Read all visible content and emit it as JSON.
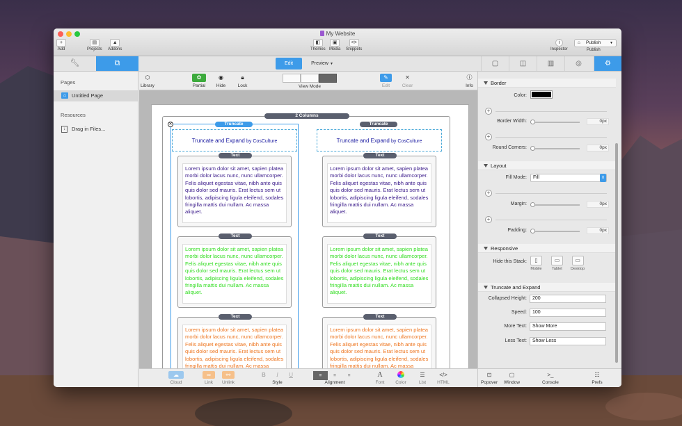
{
  "window": {
    "title": "My Website"
  },
  "toolbar": {
    "add": "Add",
    "projects": "Projects",
    "addons": "Addons",
    "themes": "Themes",
    "media": "Media",
    "snippets": "Snippets",
    "inspector": "Inspector",
    "publish_btn": "Publish",
    "publish": "Publish"
  },
  "tabs": {
    "edit": "Edit",
    "preview": "Preview"
  },
  "sidebar": {
    "pages_header": "Pages",
    "page": "Untitled Page",
    "resources_header": "Resources",
    "drag": "Drag in Files..."
  },
  "content_toolbar": {
    "library": "Library",
    "partial": "Partial",
    "hide": "Hide",
    "lock": "Lock",
    "view_mode": "View Mode",
    "edit": "Edit",
    "clear": "Clear",
    "info": "Info"
  },
  "canvas": {
    "columns_label": "2 Columns",
    "truncate_label": "Truncate",
    "truncate_text": "Truncate and Expand",
    "by_label": "by CosCulture",
    "text_label": "Text",
    "lorem": "Lorem ipsum dolor sit amet, sapien platea morbi dolor lacus nunc, nunc ullamcorper. Felis aliquet egestas vitae, nibh ante quis quis dolor sed mauris. Erat lectus sem ut lobortis, adipiscing ligula eleifend, sodales fringilla mattis dui nullam. Ac massa aliquet."
  },
  "bottom_toolbar": {
    "cloud": "Cloud",
    "link": "Link",
    "unlink": "Unlink",
    "bold": "B",
    "italic": "I",
    "underline": "U",
    "style": "Style",
    "alignment": "Alignment",
    "font": "Font",
    "color": "Color",
    "list": "List",
    "html": "HTML"
  },
  "inspector": {
    "border": {
      "header": "Border",
      "color": "Color:",
      "border_width": "Border Width:",
      "border_width_val": "0px",
      "round_corners": "Round Corners:",
      "round_corners_val": "0px"
    },
    "layout": {
      "header": "Layout",
      "fill_mode": "Fill Mode:",
      "fill_value": "Fill",
      "margin": "Margin:",
      "margin_val": "0px",
      "padding": "Padding:",
      "padding_val": "0px"
    },
    "responsive": {
      "header": "Responsive",
      "hide": "Hide this Stack:",
      "mobile": "Mobile",
      "tablet": "Tablet",
      "desktop": "Desktop"
    },
    "truncate": {
      "header": "Truncate and Expand",
      "collapsed": "Collapsed Height:",
      "collapsed_val": "200",
      "speed": "Speed:",
      "speed_val": "100",
      "more": "More Text:",
      "more_val": "Show More",
      "less": "Less Text:",
      "less_val": "Show Less"
    }
  },
  "inspector_bottom": {
    "popover": "Popover",
    "window": "Window",
    "console": "Console",
    "prefs": "Prefs"
  },
  "colors": {
    "accent": "#3d9be9",
    "purple": "#3a1a8a",
    "green": "#33dd22",
    "orange": "#ee7722"
  }
}
